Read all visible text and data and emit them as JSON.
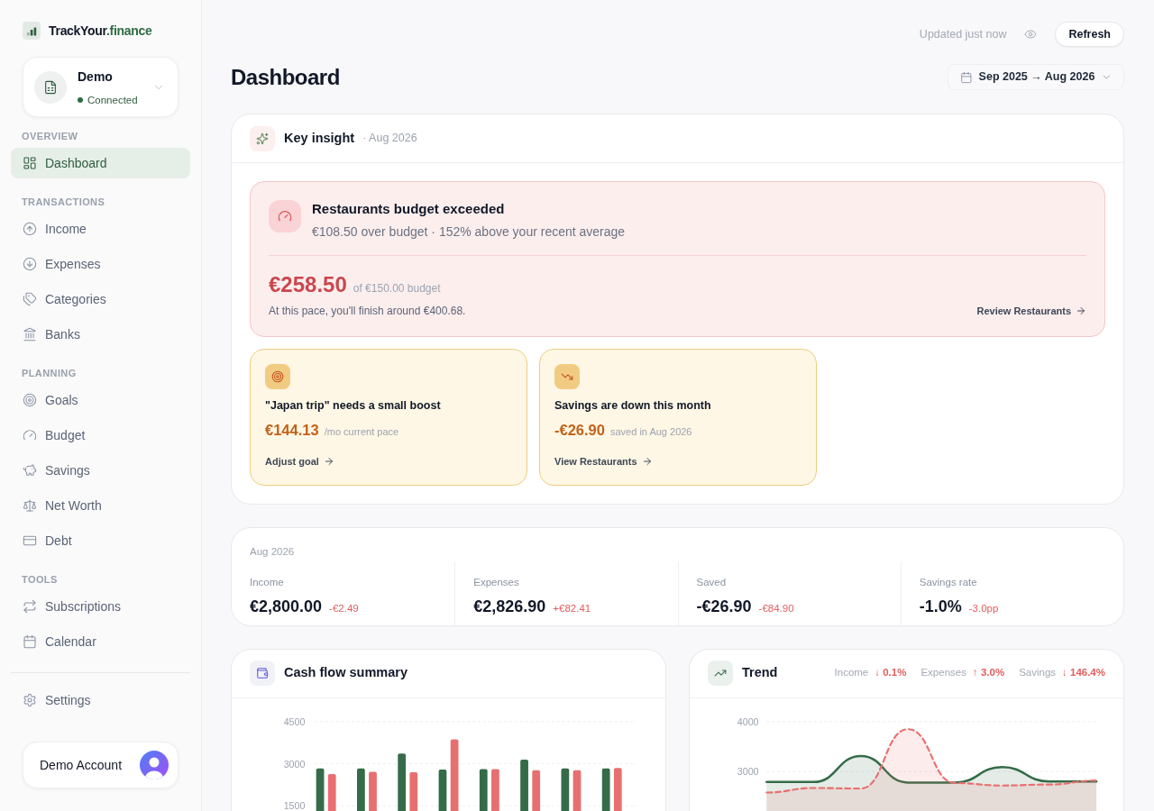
{
  "sidebar": {
    "brand": {
      "name": "TrackYour",
      "suffix": ".finance"
    },
    "account": {
      "name": "Demo",
      "status": "Connected",
      "connected": true
    },
    "sections": [
      {
        "title": "OVERVIEW",
        "items": [
          {
            "label": "Dashboard",
            "selected": true
          }
        ]
      },
      {
        "title": "TRANSACTIONS",
        "items": [
          {
            "label": "Income",
            "selected": false
          },
          {
            "label": "Expenses",
            "selected": false
          },
          {
            "label": "Categories",
            "selected": false
          },
          {
            "label": "Banks",
            "selected": false
          }
        ]
      },
      {
        "title": "PLANNING",
        "items": [
          {
            "label": "Goals",
            "selected": false
          },
          {
            "label": "Budget",
            "selected": false
          },
          {
            "label": "Savings",
            "selected": false
          },
          {
            "label": "Net Worth",
            "selected": false
          },
          {
            "label": "Debt",
            "selected": false
          }
        ]
      },
      {
        "title": "TOOLS",
        "items": [
          {
            "label": "Subscriptions",
            "selected": false
          },
          {
            "label": "Calendar",
            "selected": false
          }
        ]
      }
    ],
    "bottom_items": [
      {
        "label": "Settings",
        "selected": false
      }
    ],
    "user": {
      "name": "Demo Account"
    }
  },
  "header": {
    "updated": "Updated just now",
    "refresh": "Refresh",
    "title": "Dashboard",
    "date_range": "Sep 2025 → Aug 2026"
  },
  "key_insight": {
    "title": "Key insight",
    "period": "· Aug 2026",
    "alert": {
      "title": "Restaurants budget exceeded",
      "description": "€108.50 over budget · 152% above your recent average",
      "amount": "€258.50",
      "budget": "of €150.00 budget",
      "pace": "At this pace, you'll finish around €400.68.",
      "link": "Review Restaurants"
    },
    "tips": [
      {
        "title": "\"Japan trip\" needs a small boost",
        "amount": "€144.13",
        "note": "/mo current pace",
        "link": "Adjust goal"
      },
      {
        "title": "Savings are down this month",
        "amount": "-€26.90",
        "note": "saved in Aug 2026",
        "link": "View Restaurants"
      }
    ]
  },
  "summary": {
    "period": "Aug 2026",
    "stats": [
      {
        "label": "Income",
        "value": "€2,800.00",
        "change": "-€2.49"
      },
      {
        "label": "Expenses",
        "value": "€2,826.90",
        "change": "+€82.41"
      },
      {
        "label": "Saved",
        "value": "-€26.90",
        "change": "-€84.90"
      },
      {
        "label": "Savings rate",
        "value": "-1.0%",
        "change": "-3.0pp"
      }
    ]
  },
  "cash_flow": {
    "title": "Cash flow summary",
    "chart_data": {
      "type": "bar",
      "ylim": [
        1300,
        4500
      ],
      "yticks": [
        1500,
        3000,
        4500
      ],
      "series": [
        {
          "color": "#356b48",
          "values": [
            2830,
            2830,
            3360,
            2790,
            2810,
            3150,
            2830,
            2830
          ]
        },
        {
          "color": "#e86f6f",
          "values": [
            2630,
            2710,
            2700,
            3870,
            2810,
            2770,
            2770,
            2850
          ]
        }
      ]
    }
  },
  "trend": {
    "title": "Trend",
    "stats": [
      {
        "label": "Income",
        "change": "↓ 0.1%"
      },
      {
        "label": "Expenses",
        "change": "↑ 3.0%"
      },
      {
        "label": "Savings",
        "change": "↓ 146.4%"
      }
    ],
    "chart_data": {
      "type": "area",
      "ylim": [
        2200,
        4000
      ],
      "yticks": [
        3000,
        4000
      ],
      "series": [
        {
          "color": "#356b48",
          "line_style": "solid",
          "values": [
            2790,
            2790,
            3310,
            2780,
            2780,
            3090,
            2800,
            2800
          ]
        },
        {
          "color": "#e86f6f",
          "line_style": "dashed",
          "values": [
            2580,
            2670,
            2660,
            3850,
            2770,
            2720,
            2740,
            2820
          ]
        }
      ]
    }
  }
}
